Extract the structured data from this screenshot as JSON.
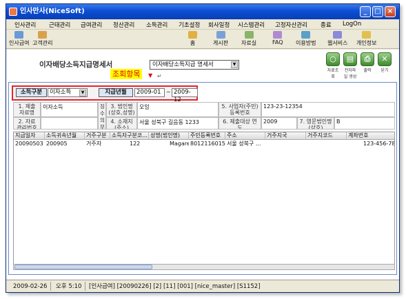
{
  "window": {
    "title": "인사만사(NiceSoft)"
  },
  "menu": [
    "인사관리",
    "근태관리",
    "급여관리",
    "정산관리",
    "소득관리",
    "기초설정",
    "회사일정",
    "시스템관리",
    "고정자산관리",
    "종료",
    "LogOn"
  ],
  "toolbar_left": [
    {
      "label": "인사급여"
    },
    {
      "label": "고객관리"
    }
  ],
  "toolbar_right": [
    {
      "label": "홈"
    },
    {
      "label": "게시판"
    },
    {
      "label": "자료실"
    },
    {
      "label": "FAQ"
    },
    {
      "label": "이용방법"
    },
    {
      "label": "웹서비스"
    },
    {
      "label": "개인정보"
    }
  ],
  "page": {
    "title": "이자배당소득지급명세서",
    "report_select": "이자배당소득지급 명세서"
  },
  "right_buttons": [
    {
      "label": "자료조회"
    },
    {
      "label": "전자파일 생성"
    },
    {
      "label": "출력"
    },
    {
      "label": "닫기"
    }
  ],
  "annotation": {
    "text": "조회항목",
    "arrow": "▼",
    "return_mark": "↵"
  },
  "condition": {
    "label_type": "소득구분",
    "type_value": "이자소득",
    "label_period": "지급년월",
    "from": "2009-01",
    "tilde": "~",
    "to": "2009-12"
  },
  "form": {
    "f1_label": "1. 제출 자료명",
    "f1_value": "이자소득",
    "f2_label": "2. 자료 관리번호",
    "side_label": "징수의무자",
    "f3_label": "3. 법인명 (상호,성명)",
    "f3_value": "오잉",
    "f4_label": "4. 소재지 (주소)",
    "f4_value": "서울 성북구 길음동 1233",
    "f5_label": "5. 사업자(주민) 등록번호",
    "f5_value": "123-23-12354",
    "f6_label": "6. 제출대상 연도",
    "f6_value": "2009",
    "f7_label": "7. 영문법인명 (상호)",
    "f7_value": "B"
  },
  "grid": {
    "columns": [
      "지급일자",
      "소득귀속년월",
      "거주구분",
      "소득자구분코...",
      "성명(법인명)",
      "주민등록번호",
      "주소",
      "거주지국",
      "거주지코드",
      "계좌번호"
    ],
    "rows": [
      [
        "20090503",
        "200905",
        "거주자",
        "122",
        "Magarett",
        "8012116015111",
        "서울 성북구 ...",
        "",
        "",
        "123-456-789"
      ]
    ]
  },
  "status": {
    "date": "2009-02-26",
    "time": "오후 5:10",
    "info": "[인사급여] [20090226] [2] [11] [001] [nice_master] [S1152]"
  }
}
